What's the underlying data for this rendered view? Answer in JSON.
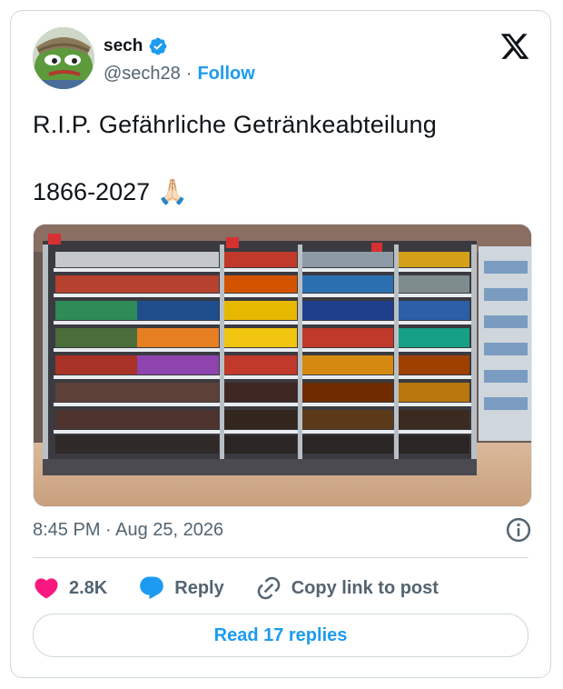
{
  "author": {
    "name": "sech",
    "handle": "@sech28",
    "separator": "·",
    "follow_label": "Follow"
  },
  "post": {
    "line1": "R.I.P.  Gefährliche Getränkeabteilung",
    "line2": "1866-2027",
    "line2_emoji": "🙏🏻",
    "image_icon": "beverage-fridge-photo"
  },
  "meta": {
    "timestamp": "8:45 PM · Aug 25, 2026"
  },
  "actions": {
    "likes": "2.8K",
    "reply_label": "Reply",
    "copy_label": "Copy link to post"
  },
  "footer": {
    "read_replies_label": "Read 17 replies"
  },
  "colors": {
    "accent": "#1d9bf0",
    "heart": "#f91880",
    "text_secondary": "#536471"
  }
}
